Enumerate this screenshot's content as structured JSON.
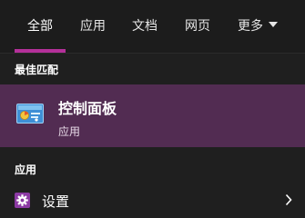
{
  "tabs": [
    {
      "label": "全部",
      "active": true
    },
    {
      "label": "应用",
      "active": false
    },
    {
      "label": "文档",
      "active": false
    },
    {
      "label": "网页",
      "active": false
    },
    {
      "label": "更多",
      "active": false
    }
  ],
  "sections": {
    "best_match": "最佳匹配",
    "apps": "应用"
  },
  "best_match": {
    "title": "控制面板",
    "subtitle": "应用",
    "icon": "control-panel-icon"
  },
  "apps": [
    {
      "label": "设置",
      "icon": "gear-icon"
    }
  ],
  "colors": {
    "background": "#1f1f1f",
    "accent": "#b4309a",
    "selected_row": "#522c52",
    "settings_icon_bg": "#8c3aa4"
  }
}
